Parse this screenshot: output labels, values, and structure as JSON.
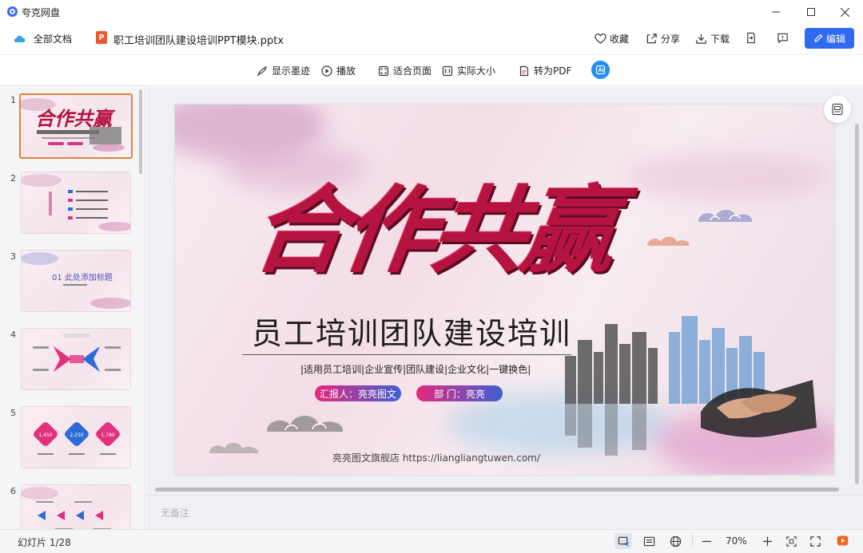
{
  "window": {
    "app_title": "夸克网盘",
    "controls": [
      "minimize",
      "maximize",
      "close"
    ]
  },
  "header": {
    "all_docs_label": "全部文档",
    "file_icon_letter": "P",
    "file_name": "职工培训团队建设培训PPT模块.pptx",
    "favorite_label": "收藏",
    "share_label": "分享",
    "download_label": "下载",
    "edit_label": "编辑"
  },
  "toolbar": {
    "show_ink_label": "显示墨迹",
    "play_label": "播放",
    "fit_page_label": "适合页面",
    "actual_size_label": "实际大小",
    "to_pdf_label": "转为PDF"
  },
  "sidebar": {
    "thumbnails": [
      {
        "number": "1",
        "active": true
      },
      {
        "number": "2"
      },
      {
        "number": "3",
        "caption": "01 此处添加标题"
      },
      {
        "number": "4"
      },
      {
        "number": "5",
        "stats": [
          "1,450",
          "2,250",
          "1,780"
        ]
      },
      {
        "number": "6"
      }
    ]
  },
  "slide": {
    "calligraphy": "合作共赢",
    "main_title": "员工培训团队建设培训",
    "tags": "|适用员工培训|企业宣传|团队建设|企业文化|一键换色|",
    "reporter": "汇报人：亮亮图文",
    "department": "部  门：亮亮",
    "footer": "亮亮图文旗舰店   https://liangliangtuwen.com/"
  },
  "notes": {
    "placeholder": "无备注"
  },
  "status": {
    "slide_counter": "幻灯片 1/28",
    "zoom": "70%"
  },
  "colors": {
    "accent_blue": "#2f6bf0",
    "active_thumb_border": "#e0823c",
    "calligraphy_red": "#b4143f",
    "play_orange": "#f0661d"
  }
}
